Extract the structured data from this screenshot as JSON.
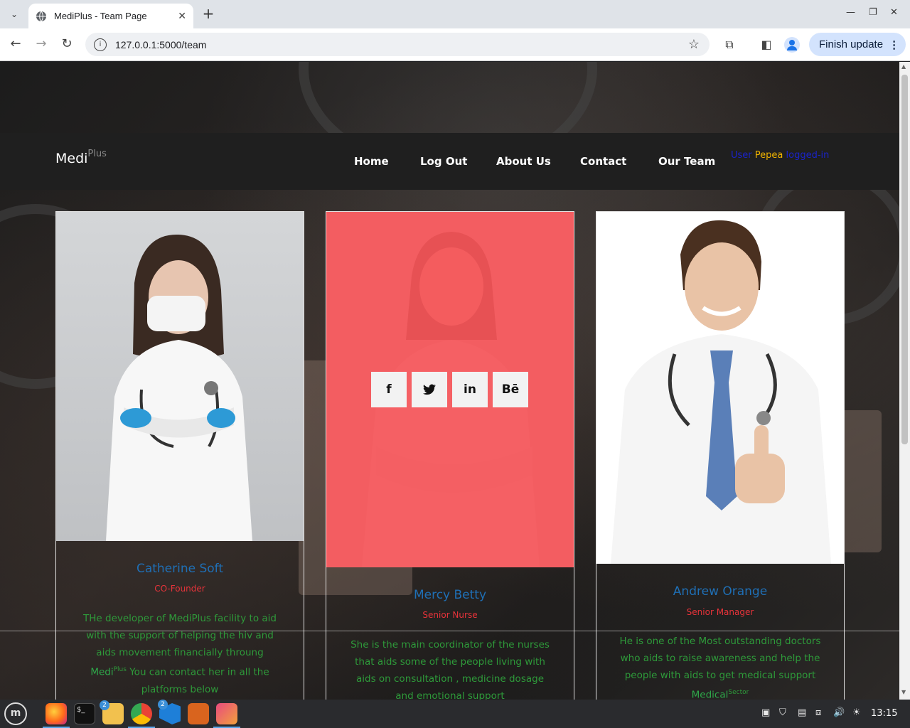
{
  "browser": {
    "tab_title": "MediPlus - Team Page",
    "url": "127.0.0.1:5000/team",
    "update_button": "Finish update"
  },
  "site": {
    "logo_main": "Medi",
    "logo_sup": "Plus",
    "menu": [
      "Home",
      "Log Out",
      "About Us",
      "Contact",
      "Our Team"
    ],
    "user_prefix": "User",
    "user_name": "Pepea",
    "user_suffix": "logged-in"
  },
  "team": [
    {
      "name": "Catherine Soft",
      "role": "CO-Founder",
      "bio_part1": "THe developer of MediPlus facility to aid with the support of helping the hiv and aids movement financially throung ",
      "bio_brand": "Medi",
      "bio_brand_sup": "Plus",
      "bio_part2": "  You can contact her in all the platforms below"
    },
    {
      "name": "Mercy Betty",
      "role": "Senior Nurse",
      "bio_part1": "She is the main coordinator of the nurses that aids some of the people living with aids on consultation , medicine dosage and emotional support"
    },
    {
      "name": "Andrew Orange",
      "role": "Senior Manager",
      "bio_part1": "He is one of the Most outstanding doctors who aids to raise awareness and help the people with aids to get medical support ",
      "bio_brand": "Medical",
      "bio_brand_sup": "Sector"
    }
  ],
  "social_buttons": [
    "f",
    "🐦",
    "in",
    "Bē"
  ],
  "taskbar": {
    "clock": "13:15",
    "files_badge": "2",
    "vscode_badge": "2"
  },
  "colors": {
    "overlay": "#f45458",
    "name": "#1f6fb5",
    "role": "#e8333a",
    "bio": "#2e9a3a"
  }
}
